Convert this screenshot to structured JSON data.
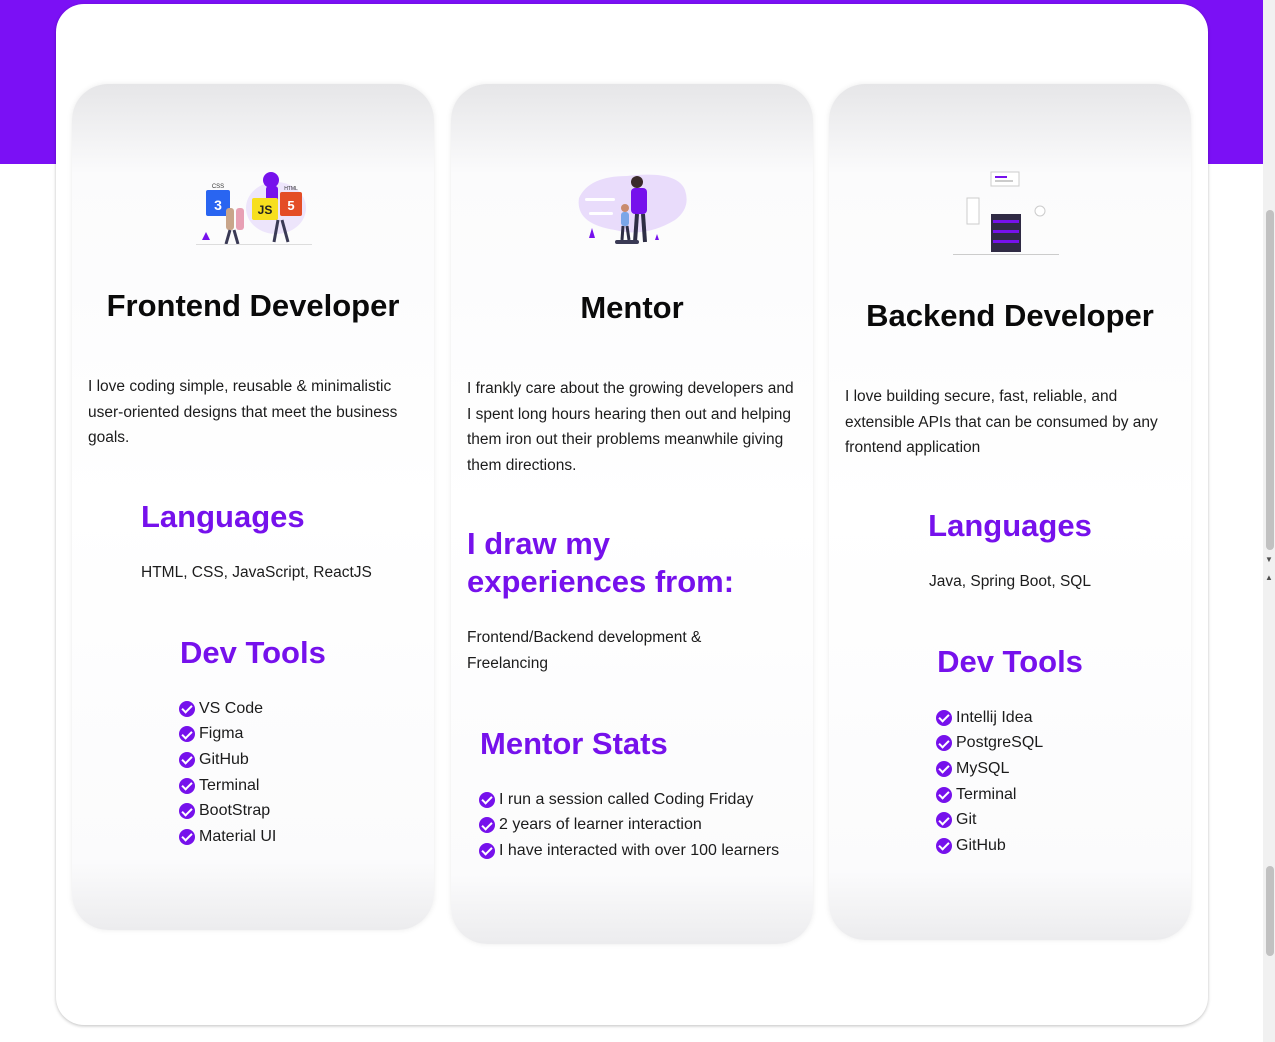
{
  "cards": [
    {
      "illustration": "frontend-technologies-illustration",
      "title": "Frontend Developer",
      "description": "I love coding simple, reusable & minimalistic user-oriented designs that meet the business goals.",
      "section1_heading": "Languages",
      "section1_text": "HTML, CSS, JavaScript, ReactJS",
      "section2_heading": "Dev Tools",
      "tools": [
        "VS Code",
        "Figma",
        "GitHub",
        "Terminal",
        "BootStrap",
        "Material UI"
      ]
    },
    {
      "illustration": "mentoring-illustration",
      "title": "Mentor",
      "description": "I frankly care about the growing developers and I spent long hours hearing then out and helping them iron out their problems meanwhile giving them directions.",
      "section1_heading": "I draw my experiences from:",
      "section1_text": "Frontend/Backend development & Freelancing",
      "section2_heading": "Mentor Stats",
      "tools": [
        "I run a session called Coding Friday",
        "2 years of learner interaction",
        "I have interacted with over 100 learners"
      ]
    },
    {
      "illustration": "server-illustration",
      "title": "Backend Developer",
      "description": "I love building secure, fast, reliable, and extensible APIs that can be consumed by any frontend application",
      "section1_heading": "Languages",
      "section1_text": "Java, Spring Boot, SQL",
      "section2_heading": "Dev Tools",
      "tools": [
        "Intellij Idea",
        "PostgreSQL",
        "MySQL",
        "Terminal",
        "Git",
        "GitHub"
      ]
    }
  ],
  "colors": {
    "accent": "#7611ec",
    "banner": "#7b10f5",
    "check_icon": "check-circle-icon"
  },
  "illustration_text": {
    "css_badge": "CSS",
    "js_badge": "JS",
    "html_badge": "HTML"
  }
}
